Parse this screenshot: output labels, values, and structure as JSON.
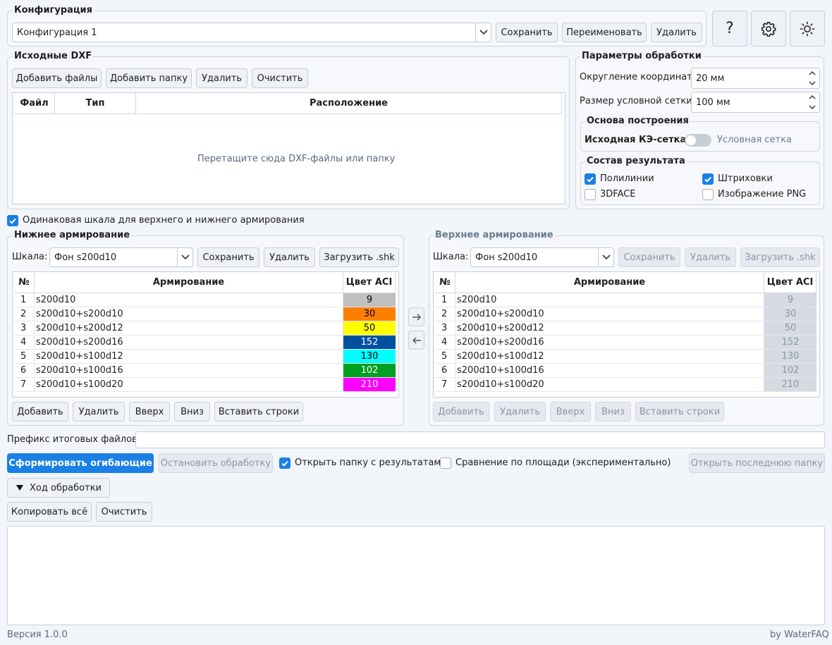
{
  "config": {
    "title": "Конфигурация",
    "selected": "Конфигурация 1",
    "save": "Сохранить",
    "rename": "Переименовать",
    "delete": "Удалить"
  },
  "top_icons": {
    "help": "?",
    "settings": "gear-icon",
    "theme": "sun-icon"
  },
  "source": {
    "title": "Исходные DXF",
    "add_files": "Добавить файлы",
    "add_folder": "Добавить папку",
    "delete": "Удалить",
    "clear": "Очистить",
    "columns": [
      "Файл",
      "Тип",
      "Расположение"
    ],
    "placeholder": "Перетащите сюда DXF-файлы или папку"
  },
  "params": {
    "title": "Параметры обработки",
    "rounding_label": "Округление координат:",
    "rounding_value": "20 мм",
    "grid_label": "Размер условной сетки:",
    "grid_value": "100 мм",
    "basis_title": "Основа построения",
    "basis_left": "Исходная КЭ-сетка",
    "basis_right": "Условная сетка",
    "result_title": "Состав результата",
    "polylines": "Полилинии",
    "hatches": "Штриховки",
    "face3d": "3DFACE",
    "png": "Изображение PNG"
  },
  "same_scale": "Одинаковая шкала для верхнего и нижнего армирования",
  "bottom": {
    "title": "Нижнее армирование",
    "scale_label": "Шкала:",
    "scale_value": "Фон s200d10",
    "save": "Сохранить",
    "delete": "Удалить",
    "load": "Загрузить .shk",
    "columns": [
      "№",
      "Армирование",
      "Цвет ACI"
    ],
    "add": "Добавить",
    "remove": "Удалить",
    "up": "Вверх",
    "down": "Вниз",
    "insert": "Вставить строки"
  },
  "top": {
    "title": "Верхнее армирование",
    "scale_label": "Шкала:",
    "scale_value": "Фон s200d10",
    "save": "Сохранить",
    "delete": "Удалить",
    "load": "Загрузить .shk",
    "columns": [
      "№",
      "Армирование",
      "Цвет ACI"
    ],
    "add": "Добавить",
    "remove": "Удалить",
    "up": "Вверх",
    "down": "Вниз",
    "insert": "Вставить строки"
  },
  "reinforcement_rows": [
    {
      "n": "1",
      "name": "s200d10",
      "aci": "9",
      "color": "#c0c0c0",
      "text": "#000000"
    },
    {
      "n": "2",
      "name": "s200d10+s200d10",
      "aci": "30",
      "color": "#ff7f00",
      "text": "#000000"
    },
    {
      "n": "3",
      "name": "s200d10+s200d12",
      "aci": "50",
      "color": "#ffff00",
      "text": "#000000"
    },
    {
      "n": "4",
      "name": "s200d10+s200d16",
      "aci": "152",
      "color": "#0050a0",
      "text": "#ffffff"
    },
    {
      "n": "5",
      "name": "s200d10+s100d12",
      "aci": "130",
      "color": "#00ffff",
      "text": "#000000"
    },
    {
      "n": "6",
      "name": "s200d10+s100d16",
      "aci": "102",
      "color": "#00a020",
      "text": "#ffffff"
    },
    {
      "n": "7",
      "name": "s200d10+s100d20",
      "aci": "210",
      "color": "#ff00ff",
      "text": "#ffffff"
    }
  ],
  "prefix_label": "Префикс итоговых файлов:",
  "prefix_value": "",
  "generate": "Сформировать огибающие",
  "stop": "Остановить обработку",
  "open_folder_cb": "Открыть папку с результатами",
  "area_compare_cb": "Сравнение по площади (экспериментально)",
  "open_last": "Открыть последнюю папку",
  "progress_toggle": "Ход обработки",
  "copy_all": "Копировать всё",
  "clear_log": "Очистить",
  "log_text": "",
  "version": "Версия 1.0.0",
  "author": "by WaterFAQ",
  "colors": {
    "accent": "#1a80e6",
    "disabled_cell": "#d6dbe2"
  }
}
